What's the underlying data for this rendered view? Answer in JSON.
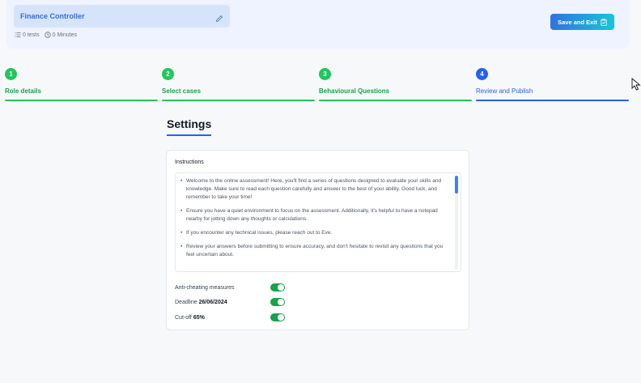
{
  "header": {
    "title": "Finance Controller",
    "tests_count": "0 tests",
    "duration": "0 Minutes",
    "save_label": "Save and Exit"
  },
  "steps": [
    {
      "number": "1",
      "label": "Role details",
      "state": "done"
    },
    {
      "number": "2",
      "label": "Select cases",
      "state": "done"
    },
    {
      "number": "3",
      "label": "Behavioural Questions",
      "state": "done"
    },
    {
      "number": "4",
      "label": "Review and Publish",
      "state": "active"
    }
  ],
  "settings": {
    "title": "Settings",
    "instructions_title": "Instructions",
    "instructions": [
      "Welcome to the online assessment! Here, you'll find a series of questions designed to evaluate your skills and knowledge. Make sure to read each question carefully and answer to the best of your ability. Good luck, and remember to take your time!",
      "Ensure you have a quiet environment to focus on the assessment. Additionally, it's helpful to have a notepad nearby for jotting down any thoughts or calculations.",
      "If you encounter any technical issues, please reach out to Eve.",
      "Review your answers before submitting to ensure accuracy, and don't hesitate to revisit any questions that you feel uncertain about."
    ],
    "anti_cheating_label": "Anti-cheating measures",
    "anti_cheating_enabled": true,
    "deadline_label": "Deadline",
    "deadline_value": "26/06/2024",
    "deadline_enabled": true,
    "cutoff_label": "Cut-off",
    "cutoff_value": "65%",
    "cutoff_enabled": true
  },
  "colors": {
    "done": "#22c55e",
    "active": "#2563eb",
    "toggle_on": "#16a34a"
  }
}
